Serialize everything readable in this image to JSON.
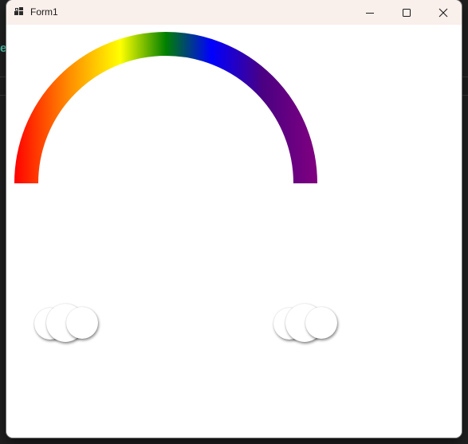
{
  "window": {
    "title": "Form1"
  },
  "icons": {
    "app": "form-app-icon",
    "minimize": "minimize-icon",
    "maximize": "maximize-icon",
    "close": "close-icon"
  },
  "background": {
    "glyph": "er"
  },
  "colors": {
    "titlebar": "#f9efeb",
    "client": "#ffffff",
    "rainbow": [
      "#ff0000",
      "#ff8c00",
      "#ffff00",
      "#008000",
      "#0000ff",
      "#4b0082",
      "#800080"
    ]
  }
}
